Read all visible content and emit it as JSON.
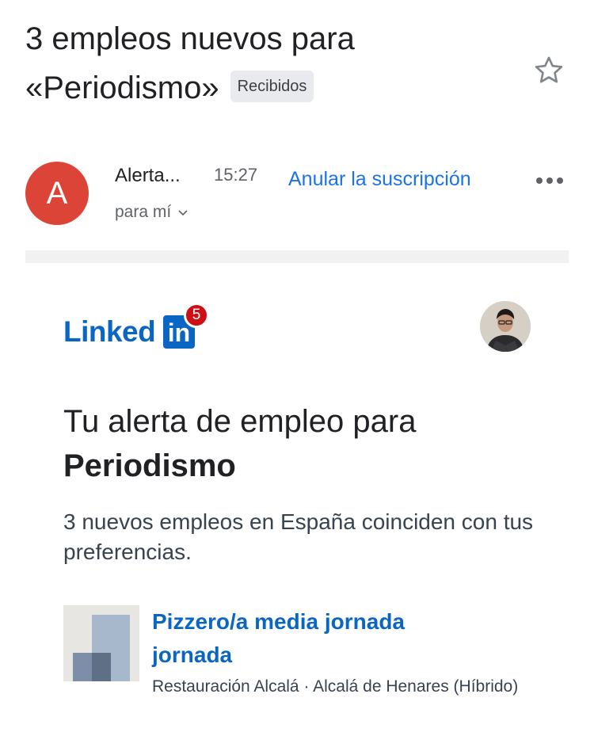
{
  "email": {
    "subject": "3 empleos nuevos para «Periodismo»",
    "label": "Recibidos",
    "sender_initial": "A",
    "sender_name": "Alerta...",
    "time": "15:27",
    "unsubscribe": "Anular la suscripción",
    "recipient": "para mí"
  },
  "linkedin": {
    "logo_word": "Linked",
    "logo_in": "in",
    "notification_count": "5",
    "brand_color": "#0a66c2"
  },
  "content": {
    "headline_prefix": "Tu alerta de empleo para",
    "headline_keyword": "Periodismo",
    "subtext": "3 nuevos empleos en España coinciden con tus preferencias."
  },
  "jobs": [
    {
      "title": "Pizzero/a media jornada jornada",
      "meta": "Restauración Alcalá · Alcalá de Henares (Híbrido)"
    }
  ],
  "icons": {
    "star": "star-icon",
    "more": "more-horizontal-icon",
    "chevron": "chevron-down-icon"
  },
  "colors": {
    "avatar": "#db4437",
    "link": "#1a73e8",
    "notification": "#cc1016"
  }
}
